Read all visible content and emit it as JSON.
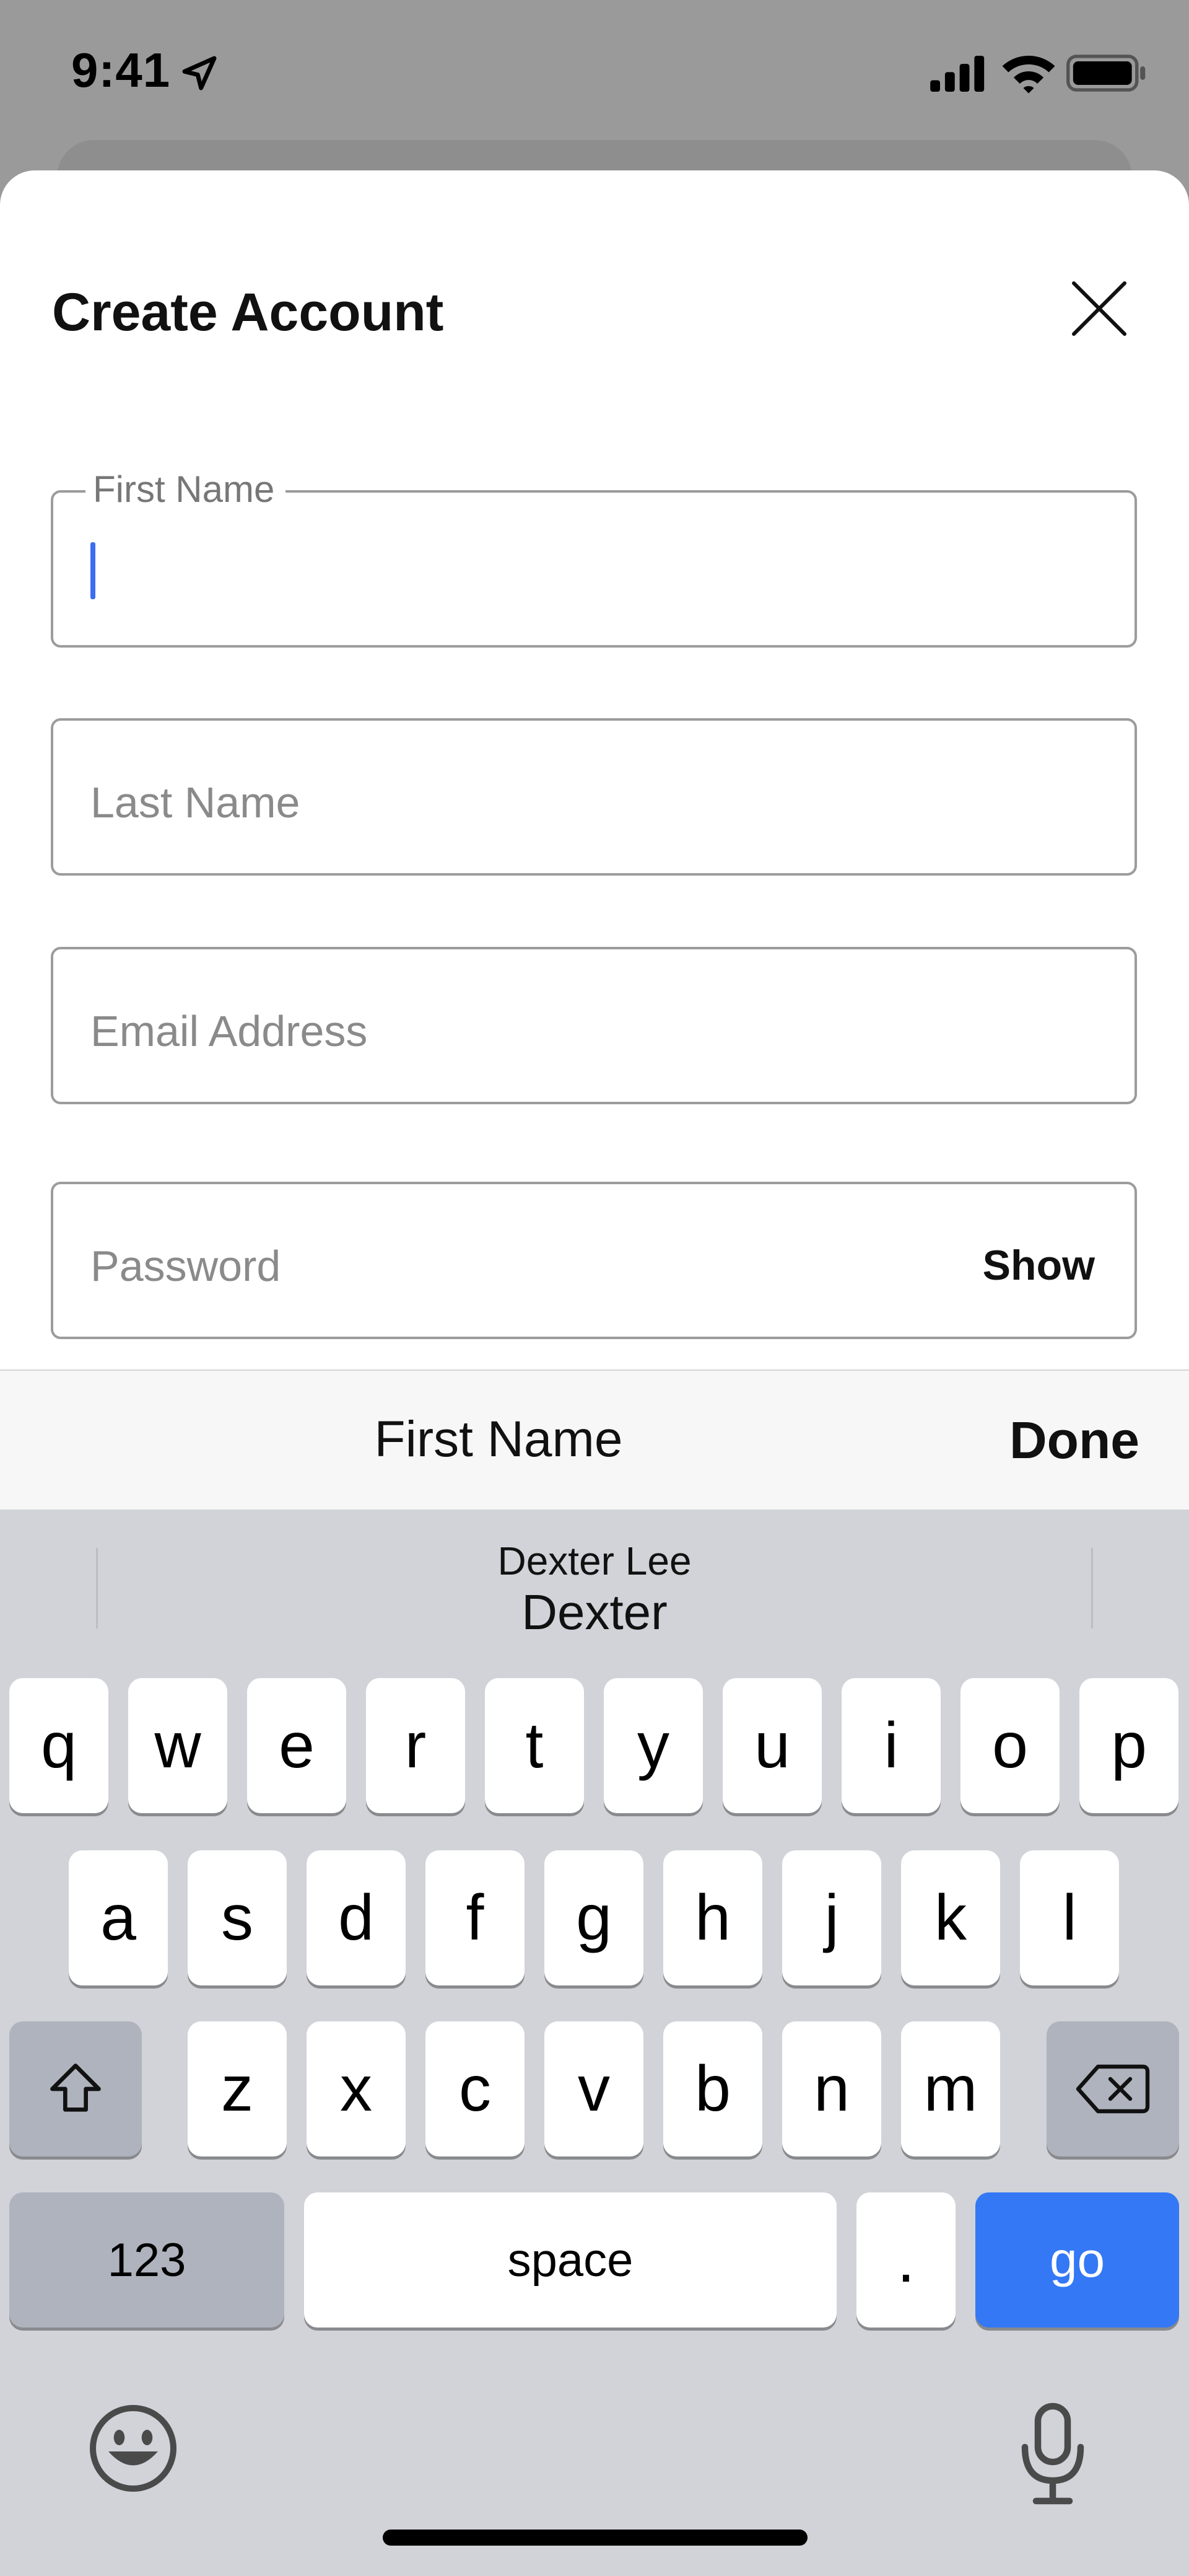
{
  "status_bar": {
    "time": "9:41",
    "icons": [
      "location-arrow-icon",
      "cellular-signal-icon",
      "wifi-icon",
      "battery-icon"
    ]
  },
  "sheet": {
    "title": "Create Account",
    "close_icon": "close-icon"
  },
  "form": {
    "first_name": {
      "label": "First Name",
      "value": ""
    },
    "last_name": {
      "placeholder": "Last Name",
      "value": ""
    },
    "email": {
      "placeholder": "Email Address",
      "value": ""
    },
    "password": {
      "placeholder": "Password",
      "value": "",
      "toggle_label": "Show"
    }
  },
  "accessory_bar": {
    "title": "First Name",
    "done_label": "Done"
  },
  "keyboard": {
    "suggestion": {
      "line1": "Dexter Lee",
      "line2": "Dexter"
    },
    "row1": [
      "q",
      "w",
      "e",
      "r",
      "t",
      "y",
      "u",
      "i",
      "o",
      "p"
    ],
    "row2": [
      "a",
      "s",
      "d",
      "f",
      "g",
      "h",
      "j",
      "k",
      "l"
    ],
    "row3": [
      "z",
      "x",
      "c",
      "v",
      "b",
      "n",
      "m"
    ],
    "numbers_label": "123",
    "space_label": "space",
    "period_label": ".",
    "go_label": "go",
    "shift_icon": "shift-icon",
    "delete_icon": "delete-icon",
    "emoji_icon": "emoji-icon",
    "mic_icon": "microphone-icon"
  },
  "colors": {
    "accent": "#3478f6",
    "caret": "#3b6ef0",
    "keyboard_bg": "#d1d3d9",
    "backdrop": "#9a9a9a"
  }
}
